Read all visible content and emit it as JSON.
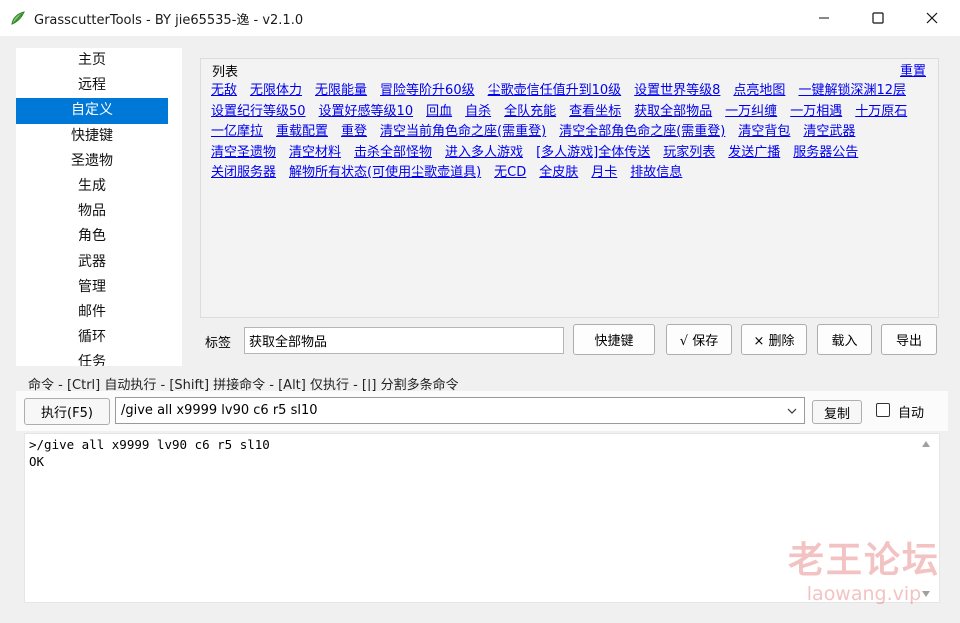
{
  "window": {
    "title": "GrasscutterTools  - BY jie65535-逸  - v2.1.0",
    "controls": [
      "minimize-icon",
      "maximize-icon",
      "close-icon"
    ]
  },
  "sidebar": {
    "items": [
      {
        "label": "主页"
      },
      {
        "label": "远程"
      },
      {
        "label": "自定义",
        "selected": true
      },
      {
        "label": "快捷键"
      },
      {
        "label": "圣遗物"
      },
      {
        "label": "生成"
      },
      {
        "label": "物品"
      },
      {
        "label": "角色"
      },
      {
        "label": "武器"
      },
      {
        "label": "管理"
      },
      {
        "label": "邮件"
      },
      {
        "label": "循环"
      },
      {
        "label": "任务"
      }
    ]
  },
  "custom": {
    "group_title": "列表",
    "reset_label": "重置",
    "links": [
      "无敌",
      "无限体力",
      "无限能量",
      "冒险等阶升60级",
      "尘歌壶信任值升到10级",
      "设置世界等级8",
      "点亮地图",
      "一键解锁深渊12层",
      "设置纪行等级50",
      "设置好感等级10",
      "回血",
      "自杀",
      "全队充能",
      "查看坐标",
      "获取全部物品",
      "一万纠缠",
      "一万相遇",
      "十万原石",
      "一亿摩拉",
      "重载配置",
      "重登",
      "清空当前角色命之座(需重登)",
      "清空全部角色命之座(需重登)",
      "清空背包",
      "清空武器",
      "清空圣遗物",
      "清空材料",
      "击杀全部怪物",
      "进入多人游戏",
      "[多人游戏]全体传送",
      "玩家列表",
      "发送广播",
      "服务器公告",
      "关闭服务器",
      "解物所有状态(可使用尘歌壶道具)",
      "无CD",
      "全皮肤",
      "月卡",
      "排故信息"
    ]
  },
  "label_row": {
    "label": "标签",
    "value": "获取全部物品",
    "buttons": {
      "hotkey": "快捷键",
      "save": "√ 保存",
      "delete": "× 删除",
      "load": "载入",
      "export": "导出"
    }
  },
  "command": {
    "help": "命令  - [Ctrl] 自动执行  - [Shift] 拼接命令  - [Alt] 仅执行  - [|] 分割多条命令",
    "execute_label": "执行(F5)",
    "input_value": "/give all x9999 lv90 c6 r5 sl10",
    "copy_label": "复制",
    "auto_label": "自动",
    "auto_checked": false
  },
  "output": {
    "lines": [
      ">/give all x9999 lv90 c6 r5 sl10",
      "OK"
    ]
  },
  "watermark": {
    "line1": "老王论坛",
    "line2": "laowang.vip"
  }
}
